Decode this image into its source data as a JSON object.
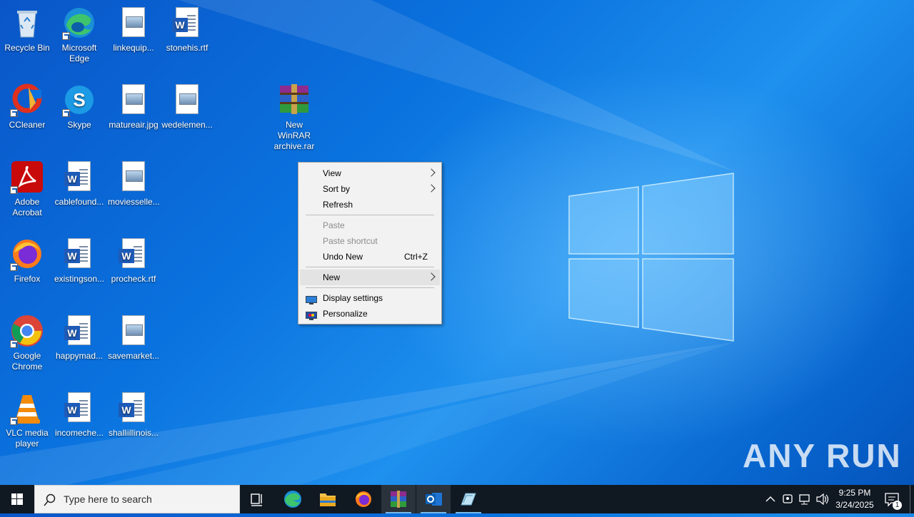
{
  "desktop_icons": [
    {
      "label": "Recycle Bin"
    },
    {
      "label": "Microsoft Edge"
    },
    {
      "label": "linkequip..."
    },
    {
      "label": "stonehis.rtf"
    },
    {
      "label": "CCleaner"
    },
    {
      "label": "Skype"
    },
    {
      "label": "matureair.jpg"
    },
    {
      "label": "wedelemen..."
    },
    {
      "label": "New WinRAR archive.rar"
    },
    {
      "label": "Adobe Acrobat"
    },
    {
      "label": "cablefound..."
    },
    {
      "label": "moviesselle..."
    },
    {
      "label": "Firefox"
    },
    {
      "label": "existingson..."
    },
    {
      "label": "procheck.rtf"
    },
    {
      "label": "Google Chrome"
    },
    {
      "label": "happymad..."
    },
    {
      "label": "savemarket..."
    },
    {
      "label": "VLC media player"
    },
    {
      "label": "incomeche..."
    },
    {
      "label": "shalliillinois..."
    }
  ],
  "context_menu": {
    "items": [
      {
        "label": "View"
      },
      {
        "label": "Sort by"
      },
      {
        "label": "Refresh"
      },
      {
        "label": "Paste"
      },
      {
        "label": "Paste shortcut"
      },
      {
        "label": "Undo New",
        "shortcut": "Ctrl+Z"
      },
      {
        "label": "New"
      },
      {
        "label": "Display settings"
      },
      {
        "label": "Personalize"
      }
    ]
  },
  "taskbar": {
    "search_placeholder": "Type here to search",
    "time": "9:25 PM",
    "date": "3/24/2025",
    "notification_count": "1"
  },
  "watermark": "ANY RUN",
  "colors": {
    "desktop": "#0a72de",
    "taskbar": "#101822",
    "menu_bg": "#f2f2f2"
  }
}
